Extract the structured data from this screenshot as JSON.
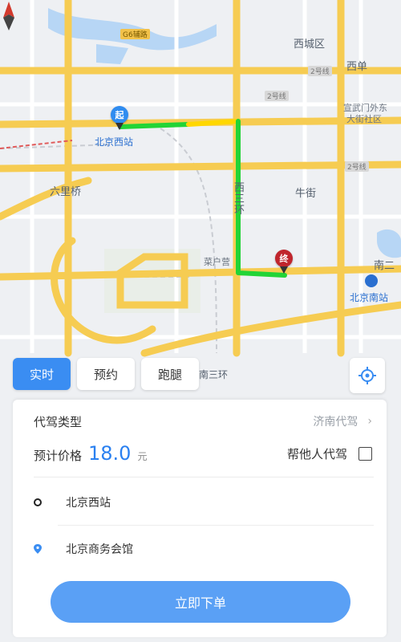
{
  "map": {
    "labels": {
      "xicheng": "西城区",
      "xidan": "西单",
      "xuanwumen": "宣武门外东",
      "dajie": "大街社区",
      "liuliqiao": "六里桥",
      "niujie": "牛街",
      "caihuying": "菜户营",
      "west_third_ring": "西三环",
      "south_third_ring": "南三环",
      "south_second": "南二",
      "beijing_west": "北京西站",
      "beijing_south": "北京南站"
    },
    "badges": {
      "b1": "G6辅路",
      "b2": "2号线",
      "b3": "2号线",
      "b4": "2号线"
    },
    "pins": {
      "start": "起",
      "end": "终"
    },
    "colors": {
      "route_green": "#22d436",
      "route_yellow": "#ffd700",
      "road_yellow": "#f6cc52",
      "start_pin": "#2f8cf0",
      "end_pin": "#c0262d"
    }
  },
  "tabs": {
    "realtime": "实时",
    "reserve": "预约",
    "errand": "跑腿"
  },
  "panel": {
    "type_label": "代驾类型",
    "type_value": "济南代驾",
    "price_label": "预计价格",
    "price_value": "18.0",
    "price_unit": "元",
    "help_label": "帮他人代驾",
    "start_address": "北京西站",
    "end_address": "北京商务会馆",
    "submit_label": "立即下单"
  },
  "theme": {
    "accent": "#3a8df2",
    "submit_bg": "#5aa0f5"
  }
}
